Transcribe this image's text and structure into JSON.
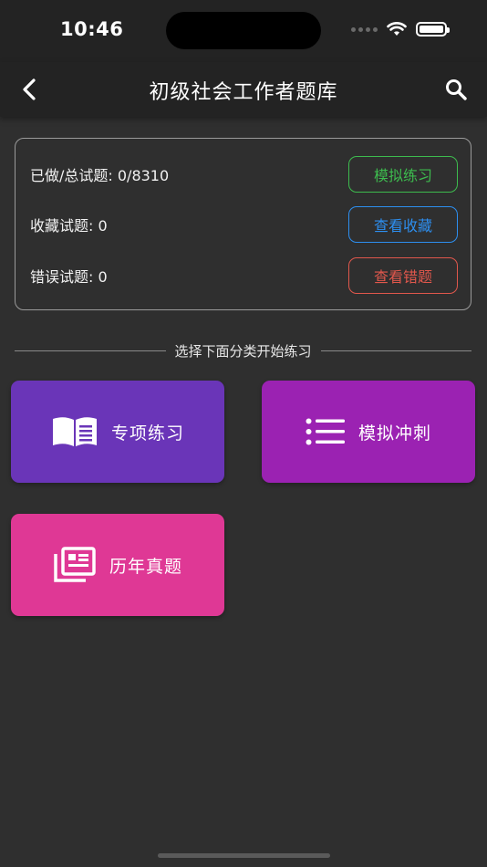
{
  "status_bar": {
    "time": "10:46"
  },
  "nav": {
    "title": "初级社会工作者题库"
  },
  "stats": {
    "done_total": "已做/总试题: 0/8310",
    "favorites": "收藏试题: 0",
    "wrong": "错误试题: 0",
    "mock_button": "模拟练习",
    "view_favorites_button": "查看收藏",
    "view_wrong_button": "查看错题"
  },
  "section": {
    "divider_text": "选择下面分类开始练习"
  },
  "categories": [
    {
      "label": "专项练习",
      "icon": "book-icon",
      "color": "#6a35b8"
    },
    {
      "label": "模拟冲刺",
      "icon": "list-icon",
      "color": "#9b22b2"
    },
    {
      "label": "历年真题",
      "icon": "documents-icon",
      "color": "#df3895"
    }
  ],
  "colors": {
    "background": "#2f2f2f",
    "bar": "#232323",
    "green": "#3dbb4e",
    "blue": "#2d8ff0",
    "red": "#e0574c"
  }
}
